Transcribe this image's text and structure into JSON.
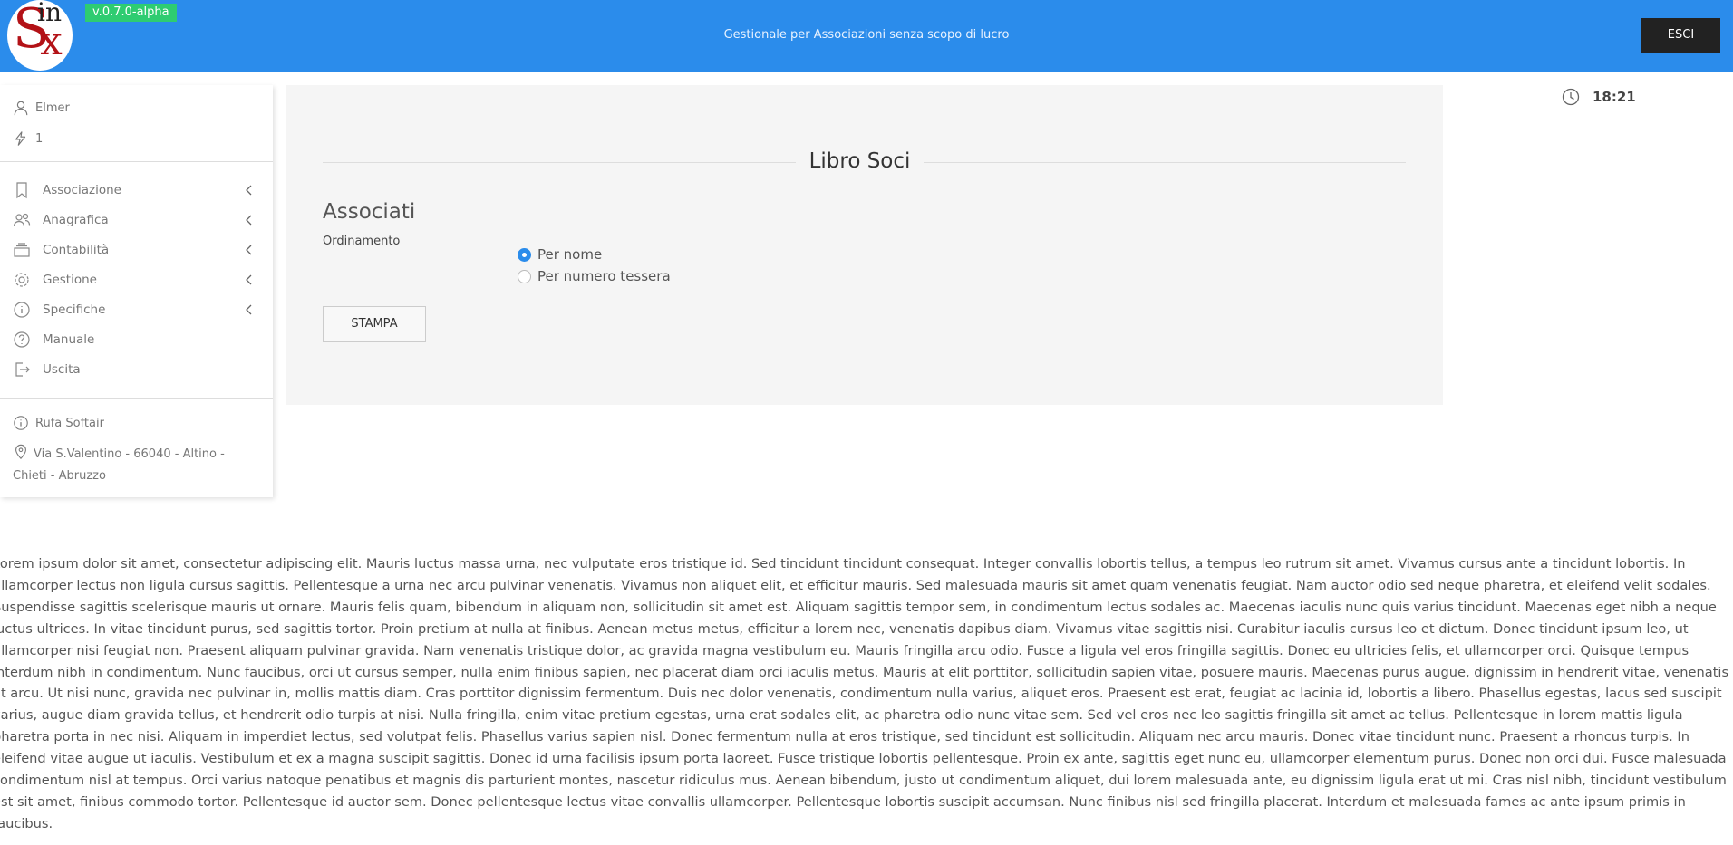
{
  "header": {
    "logo_s": "S",
    "logo_in": "in",
    "logo_x": "x",
    "version": "v.0.7.0-alpha",
    "subtitle": "Gestionale per Associazioni senza scopo di lucro",
    "exit_label": "ESCI"
  },
  "sidebar": {
    "user": "Elmer",
    "user_icon": "user-icon",
    "count": "1",
    "count_icon": "lightning-icon",
    "menu": [
      {
        "label": "Associazione",
        "icon": "bookmark-icon",
        "has_submenu": true
      },
      {
        "label": "Anagrafica",
        "icon": "users-icon",
        "has_submenu": true
      },
      {
        "label": "Contabilità",
        "icon": "stack-icon",
        "has_submenu": true
      },
      {
        "label": "Gestione",
        "icon": "gear-icon",
        "has_submenu": true
      },
      {
        "label": "Specifiche",
        "icon": "info-icon",
        "has_submenu": true
      },
      {
        "label": "Manuale",
        "icon": "help-icon",
        "has_submenu": false
      },
      {
        "label": "Uscita",
        "icon": "logout-icon",
        "has_submenu": false
      }
    ],
    "company": "Rufa Softair",
    "address": "Via S.Valentino - 66040 - Altino - Chieti - Abruzzo"
  },
  "panel": {
    "title": "Libro Soci",
    "section": "Associati",
    "sort_label": "Ordinamento",
    "options": [
      {
        "label": "Per nome",
        "checked": true
      },
      {
        "label": "Per numero tessera",
        "checked": false
      }
    ],
    "print_label": "STAMPA"
  },
  "clock": {
    "time": "18:21",
    "icon": "clock-icon"
  },
  "colors": {
    "accent": "#2b8ceb",
    "version_badge": "#2ecc71",
    "exit_button": "#222222",
    "logo_red": "#b31217"
  },
  "footer_text": "Lorem ipsum dolor sit amet, consectetur adipiscing elit. Mauris luctus massa urna, nec vulputate eros tristique id. Sed tincidunt tincidunt consequat. Integer convallis lobortis tellus, a tempus leo rutrum sit amet. Vivamus cursus ante a tincidunt lobortis. In ullamcorper lectus non ligula cursus sagittis. Pellentesque a urna nec arcu pulvinar venenatis. Vivamus non aliquet elit, et efficitur mauris. Sed malesuada mauris sit amet quam venenatis feugiat. Nam auctor odio sed neque pharetra, et eleifend velit sodales. Suspendisse sagittis scelerisque mauris ut ornare. Mauris felis quam, bibendum in aliquam non, sollicitudin sit amet est. Aliquam sagittis tempor sem, in condimentum lectus sodales ac. Maecenas iaculis nunc quis varius tincidunt. Maecenas eget nibh a neque luctus ultrices. In vitae tincidunt purus, sed sagittis tortor. Proin pretium at nulla at finibus. Aenean metus metus, efficitur a lorem nec, venenatis dapibus diam. Vivamus vitae sagittis nisi. Curabitur iaculis cursus leo et dictum. Donec tincidunt ipsum leo, ut ullamcorper nisi feugiat non. Praesent aliquam pulvinar gravida. Nam venenatis tristique dolor, ac gravida magna vestibulum eu. Mauris fringilla arcu odio. Fusce a ligula vel eros fringilla sagittis. Donec eu ultricies felis, et ullamcorper orci. Quisque tempus interdum nibh in condimentum. Nunc faucibus, orci ut cursus semper, nulla enim finibus sapien, nec placerat diam orci iaculis metus. Mauris at elit porttitor, sollicitudin sapien vitae, posuere mauris. Maecenas purus augue, dignissim in hendrerit vitae, venenatis at arcu. Ut nisi nunc, gravida nec pulvinar in, mollis mattis diam. Cras porttitor dignissim fermentum. Duis nec dolor venenatis, condimentum nulla varius, aliquet eros. Praesent est erat, feugiat ac lacinia id, lobortis a libero. Phasellus egestas, lacus sed suscipit varius, augue diam gravida tellus, et hendrerit odio turpis at nisi. Nulla fringilla, enim vitae pretium egestas, urna erat sodales elit, ac pharetra odio nunc vitae sem. Sed vel eros nec leo sagittis fringilla sit amet ac tellus. Pellentesque in lorem mattis ligula pharetra porta in nec nisi. Aliquam in imperdiet lectus, sed volutpat felis. Phasellus varius sapien nisl. Donec fermentum nulla at eros tristique, sed tincidunt est sollicitudin. Aliquam nec arcu mauris. Donec vitae tincidunt nunc. Praesent a rhoncus turpis. In eleifend vitae augue ut iaculis. Vestibulum et ex a magna suscipit sagittis. Donec id urna facilisis ipsum porta laoreet. Fusce tristique lobortis pellentesque. Proin ex ante, sagittis eget nunc eu, ullamcorper elementum purus. Donec non orci dui. Fusce malesuada condimentum nisl at tempus. Orci varius natoque penatibus et magnis dis parturient montes, nascetur ridiculus mus. Aenean bibendum, justo ut condimentum aliquet, dui lorem malesuada ante, eu dignissim ligula erat ut mi. Cras nisl nibh, tincidunt vestibulum est sit amet, finibus commodo tortor. Pellentesque id auctor sem. Donec pellentesque lectus vitae convallis ullamcorper. Pellentesque lobortis suscipit accumsan. Nunc finibus nisl sed fringilla placerat. Interdum et malesuada fames ac ante ipsum primis in faucibus."
}
